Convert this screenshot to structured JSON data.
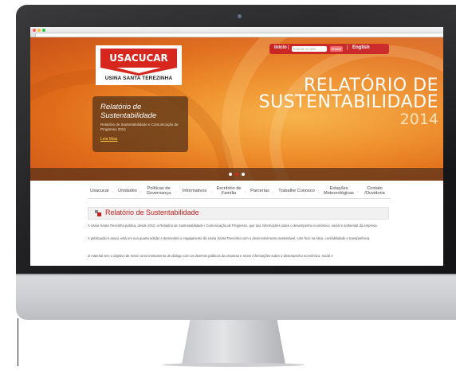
{
  "site": {
    "logo": {
      "wordmark": "USACUCAR",
      "name": "USINA SANTA TEREZINHA"
    },
    "toolbar": {
      "home": "Início",
      "separator": "|",
      "search_placeholder": "buscar no site",
      "search_button": "enviar",
      "english": "English"
    },
    "hero": {
      "title_line1": "RELATÓRIO DE",
      "title_line2": "SUSTENTABILIDADE",
      "year": "2014",
      "card": {
        "title": "Relatório de Sustentabilidade",
        "text": "Relatório de Sustentabilidade e Comunicação de Progresso 2014",
        "link": "Leia Mais"
      },
      "slides": 3,
      "active_slide": 2
    },
    "nav": [
      {
        "label": "Usacucar"
      },
      {
        "label": "Unidades"
      },
      {
        "label": "Políticas de Governança"
      },
      {
        "label": "Informativos"
      },
      {
        "label": "Escritório de Família"
      },
      {
        "label": "Parcerias"
      },
      {
        "label": "Trabalhe Conosco"
      },
      {
        "label": "Estações Meteorológicas"
      },
      {
        "label": "Contato /Ouvidoria"
      }
    ],
    "section_title": "Relatório de Sustentabilidade",
    "paragraphs": [
      "A Usina Santa Terezinha publica, desde 2010, o Relatório de Sustentabilidade / Comunicação de Progresso, que traz informações sobre o desempenho econômico, social e ambiental da empresa.",
      "A publicação é anual, está em sua quarta edição e demonstra o engajamento da Usina Santa Terezinha com o desenvolvimento sustentável, com foco na ética, confiabilidade e transparência.",
      "O material tem o objetivo de servir como instrumento de diálogo com os diversos públicos da empresa e reúne informações sobre o desempenho econômico, social e"
    ]
  },
  "colors": {
    "brand_red": "#d7261e",
    "hero_orange": "#ee8f2c",
    "bezel": "#1b1b1d",
    "chin": "#cfd0d3"
  }
}
